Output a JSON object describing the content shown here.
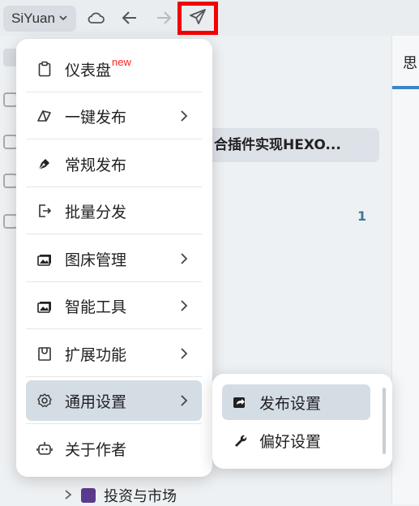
{
  "toolbar": {
    "workspace_label": "SiYuan",
    "icons": [
      "cloud-icon",
      "back-arrow-icon",
      "forward-arrow-icon",
      "send-icon"
    ]
  },
  "background": {
    "right_tab_label": "思",
    "doc_title": "合插件实现HEXO...",
    "count": "1",
    "tree_item_label": "投资与市场"
  },
  "menu": {
    "items": [
      {
        "label": "仪表盘",
        "badge": "new",
        "icon": "clipboard-icon"
      },
      {
        "label": "一键发布",
        "icon": "book-open-icon",
        "submenu": true
      },
      {
        "label": "常规发布",
        "icon": "pen-nib-icon"
      },
      {
        "label": "批量分发",
        "icon": "export-icon"
      },
      {
        "label": "图床管理",
        "icon": "image-icon",
        "submenu": true
      },
      {
        "label": "智能工具",
        "icon": "image-icon",
        "submenu": true
      },
      {
        "label": "扩展功能",
        "icon": "shopping-bag-icon",
        "submenu": true
      },
      {
        "label": "通用设置",
        "icon": "gear-icon",
        "submenu": true,
        "active": true
      },
      {
        "label": "关于作者",
        "icon": "robot-icon"
      }
    ]
  },
  "submenu": {
    "items": [
      {
        "label": "发布设置",
        "icon": "share-icon",
        "active": true
      },
      {
        "label": "偏好设置",
        "icon": "wrench-icon"
      }
    ]
  },
  "colors": {
    "highlight": "#f40000",
    "active_bg": "#d5dde4",
    "accent": "#3c84c7"
  }
}
